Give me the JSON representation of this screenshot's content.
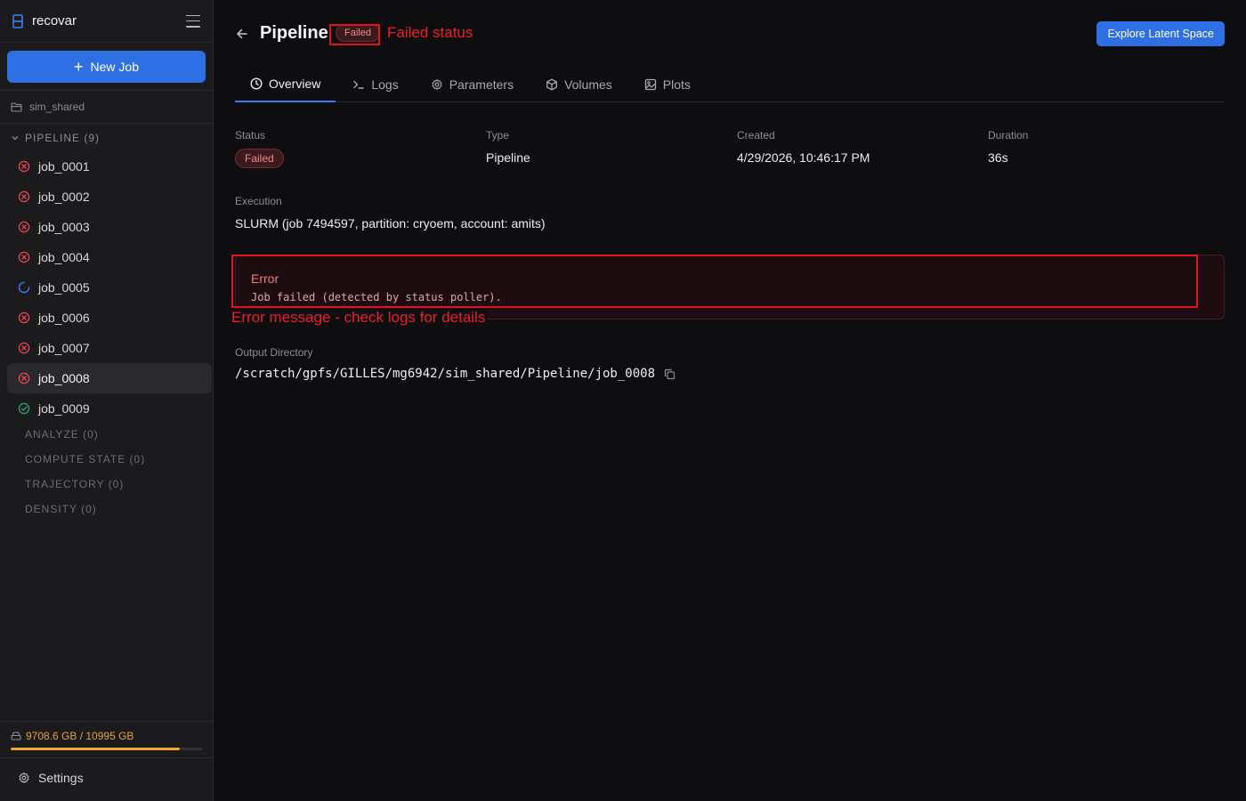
{
  "sidebar": {
    "app_title": "recovar",
    "new_job_label": "New Job",
    "folder": "sim_shared",
    "section_title": "PIPELINE (9)",
    "jobs": [
      {
        "name": "job_0001",
        "status": "failed"
      },
      {
        "name": "job_0002",
        "status": "failed"
      },
      {
        "name": "job_0003",
        "status": "failed"
      },
      {
        "name": "job_0004",
        "status": "failed"
      },
      {
        "name": "job_0005",
        "status": "running"
      },
      {
        "name": "job_0006",
        "status": "failed"
      },
      {
        "name": "job_0007",
        "status": "failed"
      },
      {
        "name": "job_0008",
        "status": "failed",
        "selected": true
      },
      {
        "name": "job_0009",
        "status": "completed"
      }
    ],
    "categories": [
      "ANALYZE (0)",
      "COMPUTE STATE (0)",
      "TRAJECTORY (0)",
      "DENSITY (0)"
    ],
    "storage": {
      "label": "9708.6 GB / 10995 GB",
      "used_fraction": 0.883
    },
    "settings_label": "Settings"
  },
  "header": {
    "title": "Pipeline",
    "status_badge": "Failed",
    "explore_button": "Explore Latent Space"
  },
  "tabs": [
    {
      "label": "Overview",
      "icon": "clock-icon",
      "active": true
    },
    {
      "label": "Logs",
      "icon": "terminal-icon"
    },
    {
      "label": "Parameters",
      "icon": "gear-icon"
    },
    {
      "label": "Volumes",
      "icon": "cube-icon"
    },
    {
      "label": "Plots",
      "icon": "image-icon"
    }
  ],
  "overview": {
    "status_label": "Status",
    "status_value": "Failed",
    "type_label": "Type",
    "type_value": "Pipeline",
    "created_label": "Created",
    "created_value": "4/29/2026, 10:46:17 PM",
    "duration_label": "Duration",
    "duration_value": "36s",
    "execution_label": "Execution",
    "execution_value": "SLURM (job 7494597, partition: cryoem, account: amits)",
    "error_title": "Error",
    "error_message": "Job failed (detected by status poller).",
    "output_label": "Output Directory",
    "output_path": "/scratch/gpfs/GILLES/mg6942/sim_shared/Pipeline/job_0008"
  },
  "annotations": {
    "status_note": "Failed status",
    "error_note": "Error message - check logs for details"
  },
  "colors": {
    "accent": "#2f6fe4",
    "failed": "#e5484d",
    "running": "#3b7bf0",
    "completed": "#30a46c",
    "storage": "#f0a530",
    "annotation": "#e0141c"
  }
}
